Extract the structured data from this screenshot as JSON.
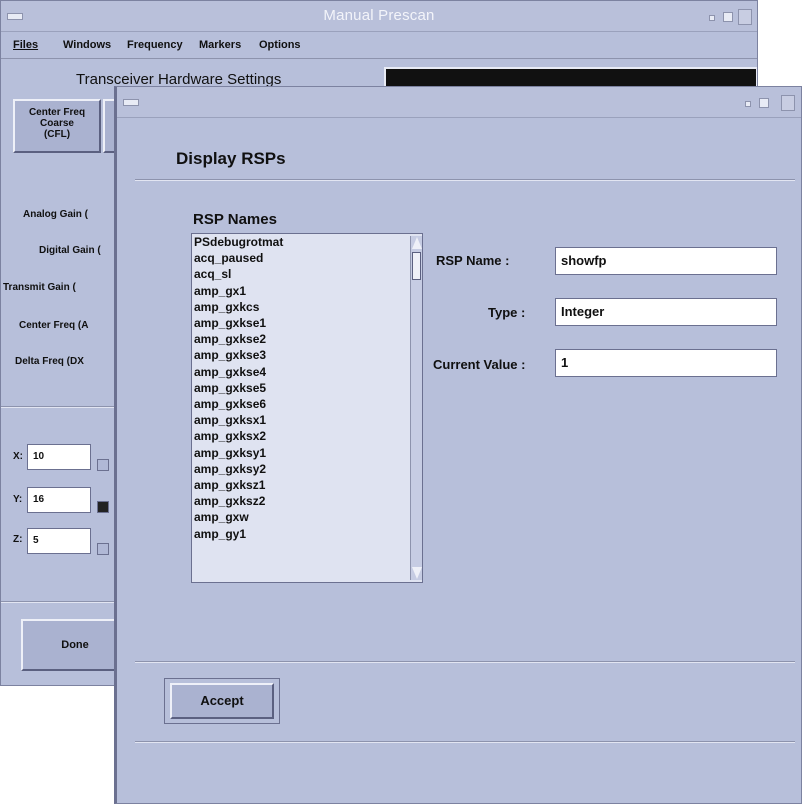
{
  "back_window": {
    "title": "Manual Prescan",
    "menu": [
      "Files",
      "Windows",
      "Frequency",
      "Markers",
      "Options"
    ],
    "section_title": "Transceiver Hardware Settings",
    "center_freq_button": "Center Freq\nCoarse\n(CFL)",
    "rows": [
      "Analog Gain (",
      "Digital Gain (",
      "Transmit Gain (",
      "Center Freq (A",
      "Delta Freq (DX"
    ],
    "coords": [
      {
        "label": "X:",
        "value": "10"
      },
      {
        "label": "Y:",
        "value": "16"
      },
      {
        "label": "Z:",
        "value": "5"
      }
    ],
    "done_label": "Done"
  },
  "front_window": {
    "heading": "Display RSPs",
    "list_title": "RSP Names",
    "rsp_names": [
      "PSdebugrotmat",
      "acq_paused",
      "acq_sl",
      "amp_gx1",
      "amp_gxkcs",
      "amp_gxkse1",
      "amp_gxkse2",
      "amp_gxkse3",
      "amp_gxkse4",
      "amp_gxkse5",
      "amp_gxkse6",
      "amp_gxksx1",
      "amp_gxksx2",
      "amp_gxksy1",
      "amp_gxksy2",
      "amp_gxksz1",
      "amp_gxksz2",
      "amp_gxw",
      "amp_gy1"
    ],
    "fields": {
      "rsp_name_label": "RSP Name :",
      "rsp_name_value": "showfp",
      "type_label": "Type :",
      "type_value": "Integer",
      "current_value_label": "Current Value :",
      "current_value": "1"
    },
    "accept_label": "Accept"
  }
}
